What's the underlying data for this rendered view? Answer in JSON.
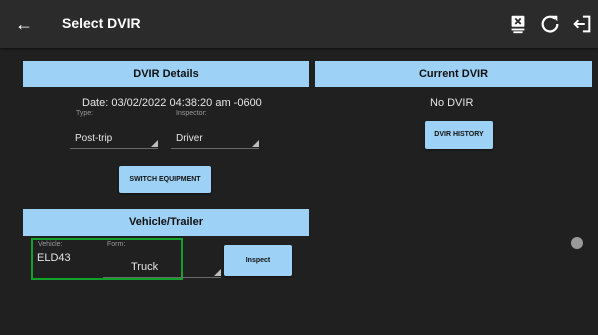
{
  "header": {
    "title": "Select DVIR",
    "back_icon": "arrow-left-icon",
    "actions": [
      "clear-icon",
      "refresh-icon",
      "logout-icon"
    ]
  },
  "dvir_details": {
    "title": "DVIR Details",
    "date": "Date: 03/02/2022 04:38:20 am -0600",
    "type_label": "Type:",
    "type_value": "Post-trip",
    "inspector_label": "Inspector:",
    "inspector_value": "Driver",
    "switch_button": "SWITCH EQUIPMENT"
  },
  "current_dvir": {
    "title": "Current DVIR",
    "status": "No DVIR",
    "history_button": "DVIR HISTORY"
  },
  "vehicle_trailer": {
    "title": "Vehicle/Trailer",
    "vehicle_label": "Vehicle:",
    "vehicle_value": "ELD43",
    "form_label": "Form:",
    "form_value": "Truck",
    "inspect_button": "Inspect"
  },
  "colors": {
    "accent": "#9ed1f6",
    "background": "#202020",
    "toolbar": "#2b2b2b",
    "selection": "#12a12a"
  }
}
